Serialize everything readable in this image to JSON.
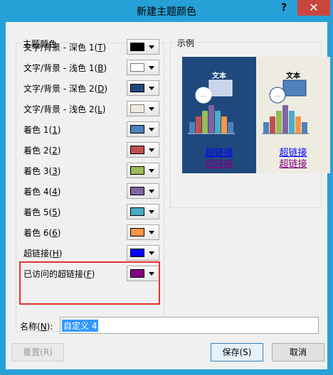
{
  "window": {
    "title": "新建主题颜色",
    "help_label": "?",
    "close_label": "✕"
  },
  "theme_colors": {
    "group_label": "主题颜色",
    "rows": [
      {
        "label": "文字/背景 - 深色 1(",
        "key": "T",
        "tail": ")",
        "color": "#000000"
      },
      {
        "label": "文字/背景 - 浅色 1(",
        "key": "B",
        "tail": ")",
        "color": "#ffffff"
      },
      {
        "label": "文字/背景 - 深色 2(",
        "key": "D",
        "tail": ")",
        "color": "#1f497d"
      },
      {
        "label": "文字/背景 - 浅色 2(",
        "key": "L",
        "tail": ")",
        "color": "#eeece1"
      },
      {
        "label": "着色 1(",
        "key": "1",
        "tail": ")",
        "color": "#4f81bd"
      },
      {
        "label": "着色 2(",
        "key": "2",
        "tail": ")",
        "color": "#c0504d"
      },
      {
        "label": "着色 3(",
        "key": "3",
        "tail": ")",
        "color": "#9bbb59"
      },
      {
        "label": "着色 4(",
        "key": "4",
        "tail": ")",
        "color": "#8064a2"
      },
      {
        "label": "着色 5(",
        "key": "5",
        "tail": ")",
        "color": "#4bacc6"
      },
      {
        "label": "着色 6(",
        "key": "6",
        "tail": ")",
        "color": "#f79646"
      },
      {
        "label": "超链接(",
        "key": "H",
        "tail": ")",
        "color": "#0000ff"
      },
      {
        "label": "已访问的超链接(",
        "key": "F",
        "tail": ")",
        "color": "#800080"
      }
    ]
  },
  "sample": {
    "group_label": "示例",
    "text_label": "文本",
    "hyperlink_label": "超链接",
    "visited_label": "超链接",
    "bubble_label": "...",
    "bar_values": [
      2,
      3,
      4,
      5,
      4,
      3,
      2
    ]
  },
  "name": {
    "label": "名称(",
    "key": "N",
    "tail": "):",
    "value": "自定义 4"
  },
  "buttons": {
    "reset": "重置(R)",
    "save": "保存(S)",
    "cancel": "取消"
  }
}
